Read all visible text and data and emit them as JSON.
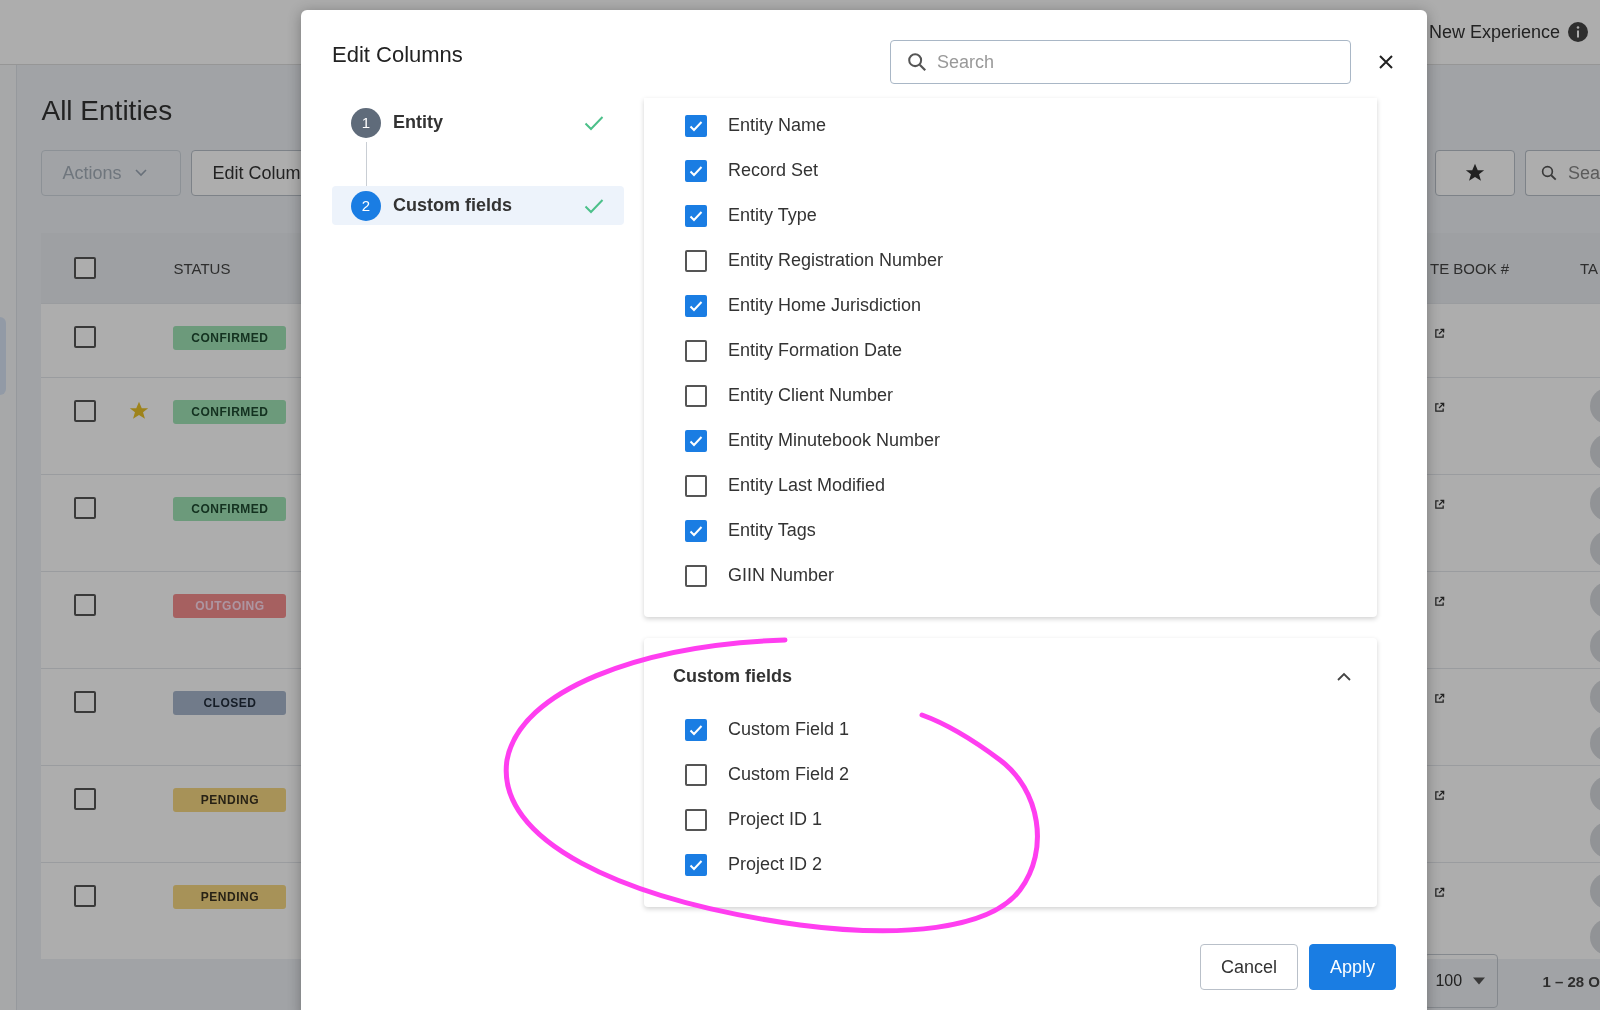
{
  "header": {
    "link": "New Experience"
  },
  "page": {
    "title": "All Entities",
    "actions_button": "Actions",
    "edit_columns_button": "Edit Colum",
    "search": {
      "placeholder": "Sea"
    }
  },
  "table": {
    "header_checked": false,
    "columns": [
      "STATUS",
      "TE BOOK #",
      "TA"
    ],
    "rows": [
      {
        "checked": false,
        "starred": false,
        "status": "CONFIRMED",
        "kind": "confirmed",
        "avatars": false
      },
      {
        "checked": false,
        "starred": true,
        "status": "CONFIRMED",
        "kind": "confirmed",
        "avatars": true
      },
      {
        "checked": false,
        "starred": false,
        "status": "CONFIRMED",
        "kind": "confirmed",
        "avatars": true
      },
      {
        "checked": false,
        "starred": false,
        "status": "OUTGOING",
        "kind": "outgoing",
        "avatars": true
      },
      {
        "checked": false,
        "starred": false,
        "status": "CLOSED",
        "kind": "closed",
        "avatars": true
      },
      {
        "checked": false,
        "starred": false,
        "status": "PENDING",
        "kind": "pending",
        "avatars": true
      },
      {
        "checked": false,
        "starred": false,
        "status": "PENDING",
        "kind": "pending",
        "avatars": true
      }
    ]
  },
  "pager": {
    "page_size": "100",
    "range": "1 – 28 O"
  },
  "modal": {
    "title": "Edit Columns",
    "search": {
      "placeholder": "Search"
    },
    "steps": [
      {
        "number": "1",
        "label": "Entity",
        "selected": false,
        "done": true
      },
      {
        "number": "2",
        "label": "Custom fields",
        "selected": true,
        "done": true
      }
    ],
    "entity_fields": [
      {
        "label": "Entity Name",
        "checked": true
      },
      {
        "label": "Record Set",
        "checked": true
      },
      {
        "label": "Entity Type",
        "checked": true
      },
      {
        "label": "Entity Registration Number",
        "checked": false
      },
      {
        "label": "Entity Home Jurisdiction",
        "checked": true
      },
      {
        "label": "Entity Formation Date",
        "checked": false
      },
      {
        "label": "Entity Client Number",
        "checked": false
      },
      {
        "label": "Entity Minutebook Number",
        "checked": true
      },
      {
        "label": "Entity Last Modified",
        "checked": false
      },
      {
        "label": "Entity Tags",
        "checked": true
      },
      {
        "label": "GIIN Number",
        "checked": false
      }
    ],
    "custom_section": {
      "title": "Custom fields",
      "expanded": true,
      "fields": [
        {
          "label": "Custom Field 1",
          "checked": true
        },
        {
          "label": "Custom Field 2",
          "checked": false
        },
        {
          "label": "Project ID 1",
          "checked": false
        },
        {
          "label": "Project ID 2",
          "checked": true
        }
      ]
    },
    "buttons": {
      "cancel": "Cancel",
      "apply": "Apply"
    }
  }
}
